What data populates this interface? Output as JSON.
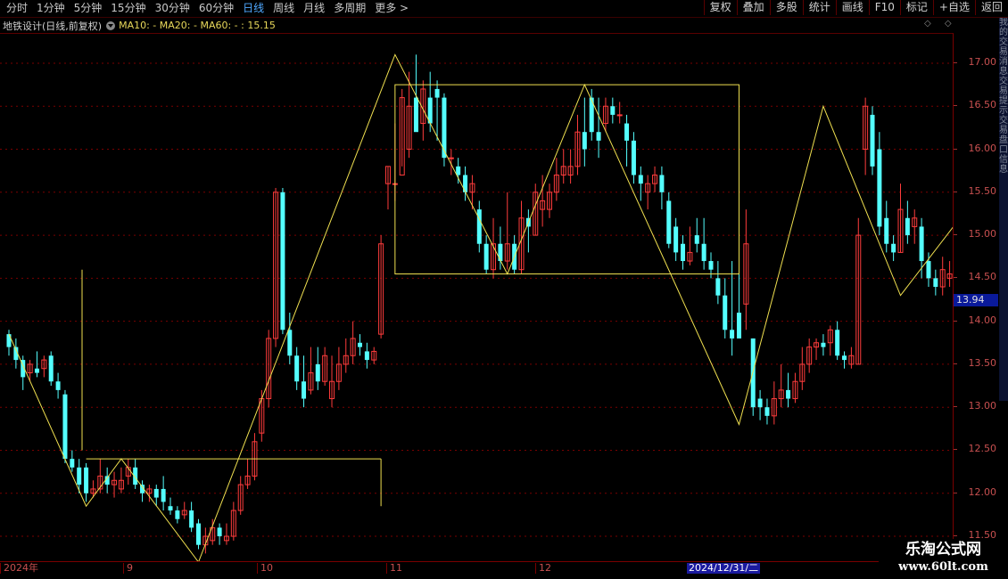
{
  "toolbar": {
    "periods": [
      "分时",
      "1分钟",
      "5分钟",
      "15分钟",
      "30分钟",
      "60分钟",
      "日线",
      "周线",
      "月线",
      "多周期",
      "更多 >"
    ],
    "active_period": "日线",
    "tools": [
      "复权",
      "叠加",
      "多股",
      "统计",
      "画线",
      "F10",
      "标记",
      "+自选",
      "返回"
    ]
  },
  "info": {
    "title": "地铁设计(日线,前复权)",
    "ma_text": "MA10: - MA20: - MA60: - : 15.15",
    "diamonds": "◇ ◇"
  },
  "yaxis": {
    "ticks": [
      "17.00",
      "16.50",
      "16.00",
      "15.50",
      "15.00",
      "14.50",
      "14.00",
      "13.50",
      "13.00",
      "12.50",
      "12.00",
      "11.50"
    ],
    "current_price": "13.94"
  },
  "xaxis": {
    "labels": [
      "2024年",
      "9",
      "10",
      "11",
      "12"
    ],
    "selected_date": "2024/12/31/二"
  },
  "right_panel": "我的交易消息交易提示交易盘口信息",
  "watermark": {
    "line1": "乐淘公式网",
    "line2": "www.60lt.com"
  },
  "colors": {
    "up": "#ff3c3c",
    "down": "#54ffff",
    "line": "#f0e050",
    "grid": "#7a0000",
    "box": "#f0e050"
  },
  "chart_data": {
    "type": "candlestick",
    "ylim": [
      11.2,
      17.3
    ],
    "candles": [
      [
        13.85,
        13.7,
        13.9,
        13.6
      ],
      [
        13.7,
        13.55,
        13.8,
        13.45
      ],
      [
        13.55,
        13.35,
        13.6,
        13.2
      ],
      [
        13.4,
        13.5,
        13.55,
        13.3
      ],
      [
        13.45,
        13.4,
        13.65,
        13.35
      ],
      [
        13.45,
        13.55,
        13.6,
        13.35
      ],
      [
        13.6,
        13.3,
        13.65,
        13.25
      ],
      [
        13.3,
        13.2,
        13.4,
        13.1
      ],
      [
        13.15,
        12.4,
        13.2,
        12.35
      ],
      [
        12.4,
        12.3,
        12.5,
        12.25
      ],
      [
        12.3,
        12.1,
        12.4,
        12.0
      ],
      [
        12.3,
        12.0,
        12.35,
        11.9
      ],
      [
        12.0,
        12.05,
        12.15,
        11.95
      ],
      [
        12.05,
        12.2,
        12.4,
        12.0
      ],
      [
        12.2,
        12.1,
        12.3,
        12.0
      ],
      [
        12.1,
        12.15,
        12.25,
        11.95
      ],
      [
        12.05,
        12.15,
        12.3,
        12.0
      ],
      [
        12.2,
        12.3,
        12.4,
        12.1
      ],
      [
        12.3,
        12.1,
        12.4,
        12.05
      ],
      [
        12.1,
        12.0,
        12.15,
        11.9
      ],
      [
        12.0,
        12.05,
        12.1,
        11.9
      ],
      [
        12.05,
        11.95,
        12.1,
        11.85
      ],
      [
        12.05,
        11.9,
        12.2,
        11.8
      ],
      [
        11.85,
        11.8,
        11.95,
        11.75
      ],
      [
        11.8,
        11.7,
        11.85,
        11.65
      ],
      [
        11.75,
        11.8,
        11.9,
        11.7
      ],
      [
        11.8,
        11.6,
        11.9,
        11.55
      ],
      [
        11.65,
        11.4,
        11.7,
        11.35
      ],
      [
        11.4,
        11.5,
        11.6,
        11.3
      ],
      [
        11.45,
        11.6,
        11.7,
        11.4
      ],
      [
        11.6,
        11.5,
        11.65,
        11.4
      ],
      [
        11.45,
        11.5,
        11.65,
        11.4
      ],
      [
        11.5,
        11.8,
        11.9,
        11.45
      ],
      [
        11.8,
        12.1,
        12.2,
        11.75
      ],
      [
        12.1,
        12.2,
        12.4,
        12.05
      ],
      [
        12.2,
        12.6,
        12.7,
        12.15
      ],
      [
        12.7,
        13.1,
        13.2,
        12.6
      ],
      [
        13.1,
        13.8,
        13.9,
        13.0
      ],
      [
        13.8,
        15.5,
        15.55,
        13.7
      ],
      [
        15.5,
        13.9,
        15.55,
        13.85
      ],
      [
        13.9,
        13.6,
        14.1,
        13.5
      ],
      [
        13.6,
        13.3,
        13.7,
        13.2
      ],
      [
        13.3,
        13.1,
        13.6,
        13.0
      ],
      [
        13.2,
        13.4,
        13.7,
        13.15
      ],
      [
        13.5,
        13.3,
        13.7,
        13.2
      ],
      [
        13.3,
        13.6,
        13.7,
        13.25
      ],
      [
        13.1,
        13.3,
        13.6,
        13.0
      ],
      [
        13.3,
        13.5,
        13.7,
        13.2
      ],
      [
        13.5,
        13.6,
        13.8,
        13.4
      ],
      [
        13.6,
        13.8,
        14.0,
        13.5
      ],
      [
        13.75,
        13.7,
        13.85,
        13.6
      ],
      [
        13.65,
        13.55,
        13.75,
        13.45
      ],
      [
        13.55,
        13.65,
        13.7,
        13.5
      ],
      [
        13.85,
        14.9,
        15.0,
        13.8
      ],
      [
        15.6,
        15.8,
        15.8,
        15.3
      ],
      [
        15.6,
        15.6,
        16.3,
        15.4
      ],
      [
        15.7,
        16.6,
        16.7,
        15.8
      ],
      [
        16.0,
        16.5,
        16.9,
        15.9
      ],
      [
        16.6,
        16.2,
        17.1,
        16.3
      ],
      [
        16.3,
        16.7,
        16.8,
        16.1
      ],
      [
        16.6,
        16.3,
        16.9,
        16.2
      ],
      [
        16.7,
        16.6,
        16.8,
        16.1
      ],
      [
        16.6,
        15.9,
        16.65,
        15.8
      ],
      [
        15.9,
        15.9,
        16.0,
        15.7
      ],
      [
        15.8,
        15.7,
        15.9,
        15.6
      ],
      [
        15.7,
        15.5,
        15.8,
        15.4
      ],
      [
        15.5,
        15.6,
        15.7,
        15.3
      ],
      [
        15.3,
        14.9,
        15.4,
        14.8
      ],
      [
        14.9,
        14.6,
        15.0,
        14.55
      ],
      [
        14.6,
        14.9,
        15.2,
        14.5
      ],
      [
        14.9,
        14.7,
        15.1,
        14.6
      ],
      [
        14.7,
        14.9,
        15.5,
        14.6
      ],
      [
        14.9,
        14.6,
        15.0,
        14.55
      ],
      [
        14.6,
        15.2,
        15.4,
        14.55
      ],
      [
        15.2,
        15.1,
        15.3,
        14.8
      ],
      [
        15.0,
        15.5,
        15.6,
        15.0
      ],
      [
        15.3,
        15.4,
        15.7,
        15.1
      ],
      [
        15.3,
        15.5,
        15.6,
        15.2
      ],
      [
        15.5,
        15.7,
        15.9,
        15.4
      ],
      [
        15.7,
        15.8,
        16.0,
        15.6
      ],
      [
        15.7,
        15.8,
        16.0,
        15.6
      ],
      [
        15.8,
        16.2,
        16.4,
        15.7
      ],
      [
        16.2,
        16.0,
        16.6,
        15.8
      ],
      [
        16.6,
        16.2,
        16.7,
        16.1
      ],
      [
        16.2,
        16.1,
        16.6,
        15.9
      ],
      [
        16.3,
        16.5,
        16.6,
        16.2
      ],
      [
        16.5,
        16.4,
        16.6,
        16.3
      ],
      [
        16.4,
        16.4,
        16.55,
        16.3
      ],
      [
        16.3,
        16.1,
        16.4,
        15.8
      ],
      [
        16.1,
        15.7,
        16.2,
        15.6
      ],
      [
        15.7,
        15.6,
        15.8,
        15.4
      ],
      [
        15.5,
        15.6,
        15.7,
        15.3
      ],
      [
        15.6,
        15.7,
        15.8,
        15.5
      ],
      [
        15.7,
        15.5,
        15.8,
        15.3
      ],
      [
        15.4,
        14.9,
        15.5,
        14.85
      ],
      [
        15.1,
        14.8,
        15.2,
        14.7
      ],
      [
        14.9,
        14.7,
        15.0,
        14.6
      ],
      [
        14.7,
        14.8,
        15.1,
        14.65
      ],
      [
        15.0,
        14.9,
        15.2,
        14.8
      ],
      [
        14.9,
        14.7,
        15.2,
        14.6
      ],
      [
        14.7,
        14.6,
        14.8,
        14.5
      ],
      [
        14.5,
        14.3,
        14.7,
        14.2
      ],
      [
        14.3,
        13.9,
        14.5,
        13.8
      ],
      [
        13.9,
        13.8,
        14.7,
        13.6
      ],
      [
        14.1,
        13.8,
        14.6,
        13.8
      ],
      [
        14.2,
        14.9,
        15.3,
        13.9
      ],
      [
        13.8,
        13.0,
        13.8,
        12.9
      ],
      [
        13.1,
        13.0,
        13.2,
        12.85
      ],
      [
        13.0,
        12.9,
        13.1,
        12.8
      ],
      [
        12.9,
        13.1,
        13.3,
        12.8
      ],
      [
        13.1,
        13.2,
        13.5,
        13.0
      ],
      [
        13.2,
        13.1,
        13.4,
        13.0
      ],
      [
        13.1,
        13.3,
        13.4,
        13.05
      ],
      [
        13.3,
        13.5,
        13.7,
        13.2
      ],
      [
        13.5,
        13.7,
        13.8,
        13.4
      ],
      [
        13.7,
        13.75,
        13.8,
        13.55
      ],
      [
        13.75,
        13.7,
        13.85,
        13.6
      ],
      [
        13.75,
        13.9,
        13.95,
        13.6
      ],
      [
        13.9,
        13.6,
        14.0,
        13.55
      ],
      [
        13.6,
        13.55,
        13.65,
        13.45
      ],
      [
        13.5,
        13.6,
        13.7,
        13.45
      ],
      [
        13.5,
        15.0,
        15.2,
        13.5
      ],
      [
        16.0,
        16.5,
        16.6,
        15.7
      ],
      [
        16.4,
        15.8,
        16.5,
        15.7
      ],
      [
        16.0,
        15.1,
        16.2,
        15.0
      ],
      [
        15.2,
        14.9,
        15.4,
        14.8
      ],
      [
        14.9,
        14.8,
        15.0,
        14.7
      ],
      [
        14.8,
        15.3,
        15.6,
        14.8
      ],
      [
        15.2,
        15.0,
        15.4,
        14.9
      ],
      [
        15.1,
        15.2,
        15.3,
        14.9
      ],
      [
        15.1,
        14.7,
        15.2,
        14.5
      ],
      [
        14.7,
        14.5,
        14.8,
        14.4
      ],
      [
        14.5,
        14.4,
        14.6,
        14.3
      ],
      [
        14.4,
        14.6,
        14.75,
        14.3
      ],
      [
        14.5,
        14.55,
        14.7,
        14.4
      ],
      [
        14.55,
        14.8,
        14.8,
        14.5
      ],
      [
        14.7,
        14.65,
        14.8,
        14.5
      ],
      [
        14.7,
        14.75,
        14.85,
        14.55
      ],
      [
        14.75,
        14.7,
        14.9,
        14.6
      ],
      [
        14.7,
        14.6,
        14.8,
        14.5
      ],
      [
        14.6,
        14.9,
        15.0,
        14.5
      ],
      [
        14.9,
        14.7,
        15.2,
        14.6
      ],
      [
        14.8,
        14.5,
        15.1,
        14.4
      ],
      [
        14.6,
        14.75,
        14.85,
        14.4
      ],
      [
        14.7,
        14.9,
        15.1,
        14.6
      ]
    ],
    "trend_line": [
      [
        13.85,
        0
      ],
      [
        11.85,
        11
      ],
      [
        12.4,
        16
      ],
      [
        11.2,
        27
      ],
      [
        17.1,
        55
      ],
      [
        14.55,
        71
      ],
      [
        16.75,
        82
      ],
      [
        12.8,
        104
      ],
      [
        16.5,
        116
      ],
      [
        14.3,
        127
      ],
      [
        15.15,
        135
      ]
    ],
    "boxes": [
      {
        "x1": 55,
        "x2": 104,
        "y1": 16.75,
        "y2": 14.55
      }
    ],
    "hline": {
      "y": 12.4,
      "x1": 11,
      "x2": 53
    }
  }
}
